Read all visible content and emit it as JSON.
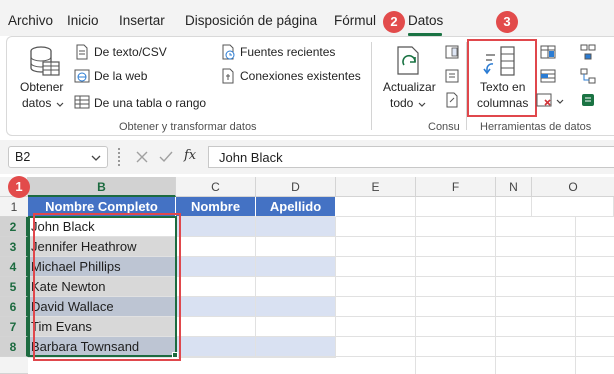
{
  "menu": {
    "tabs": [
      "Archivo",
      "Inicio",
      "Insertar",
      "Disposición de página",
      "Fórmul",
      "Datos"
    ],
    "active": "Datos"
  },
  "ribbon": {
    "get_data": {
      "label_line1": "Obtener",
      "label_line2": "datos"
    },
    "from_text_csv": "De texto/CSV",
    "from_web": "De la web",
    "from_table": "De una tabla o rango",
    "recent_sources": "Fuentes recientes",
    "existing_connections": "Conexiones existentes",
    "group_get_transform": "Obtener y transformar datos",
    "refresh": {
      "label_line1": "Actualizar",
      "label_line2": "todo"
    },
    "group_queries": "Consu",
    "text_to_columns": {
      "label_line1": "Texto en",
      "label_line2": "columnas"
    },
    "group_data_tools": "Herramientas de datos"
  },
  "callouts": [
    "1",
    "2",
    "3"
  ],
  "formula_bar": {
    "name_box": "B2",
    "fx": "fx",
    "value": "John Black"
  },
  "grid": {
    "columns": [
      "B",
      "C",
      "D",
      "E",
      "F",
      "N",
      "O"
    ],
    "rows": [
      "1",
      "2",
      "3",
      "4",
      "5",
      "6",
      "7",
      "8"
    ],
    "table_headers": [
      "Nombre Completo",
      "Nombre",
      "Apellido"
    ],
    "names": [
      "John Black",
      "Jennifer Heathrow",
      "Michael Phillips",
      "Kate Newton",
      "David Wallace",
      "Tim Evans",
      "Barbara Townsand"
    ]
  },
  "colors": {
    "accent_green": "#1d6b40",
    "table_header_blue": "#4472c4",
    "band_light_blue": "#d9e1f2",
    "callout_red": "#e24b4b"
  }
}
